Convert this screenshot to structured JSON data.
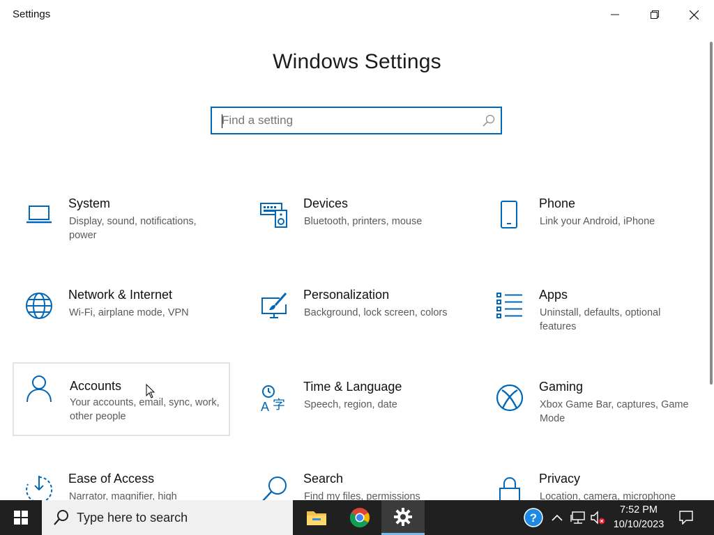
{
  "window": {
    "title": "Settings",
    "controls": {
      "minimize": "minimize-icon",
      "maximize": "restore-icon",
      "close": "close-icon"
    }
  },
  "main": {
    "heading": "Windows Settings",
    "search": {
      "placeholder": "Find a setting",
      "value": ""
    }
  },
  "categories": [
    {
      "title": "System",
      "description": "Display, sound, notifications, power",
      "icon": "laptop-icon"
    },
    {
      "title": "Devices",
      "description": "Bluetooth, printers, mouse",
      "icon": "keyboard-speaker-icon"
    },
    {
      "title": "Phone",
      "description": "Link your Android, iPhone",
      "icon": "phone-icon"
    },
    {
      "title": "Network & Internet",
      "description": "Wi-Fi, airplane mode, VPN",
      "icon": "globe-icon"
    },
    {
      "title": "Personalization",
      "description": "Background, lock screen, colors",
      "icon": "paintbrush-icon"
    },
    {
      "title": "Apps",
      "description": "Uninstall, defaults, optional features",
      "icon": "apps-list-icon"
    },
    {
      "title": "Accounts",
      "description": "Your accounts, email, sync, work, other people",
      "icon": "person-icon"
    },
    {
      "title": "Time & Language",
      "description": "Speech, region, date",
      "icon": "time-language-icon"
    },
    {
      "title": "Gaming",
      "description": "Xbox Game Bar, captures, Game Mode",
      "icon": "xbox-icon"
    },
    {
      "title": "Ease of Access",
      "description": "Narrator, magnifier, high",
      "icon": "ease-of-access-icon"
    },
    {
      "title": "Search",
      "description": "Find my files, permissions",
      "icon": "search-icon"
    },
    {
      "title": "Privacy",
      "description": "Location, camera, microphone",
      "icon": "lock-icon"
    }
  ],
  "taskbar": {
    "search_placeholder": "Type here to search",
    "clock": {
      "time": "7:52 PM",
      "date": "10/10/2023"
    },
    "colors": {
      "background": "#202020",
      "accent": "#0067b8"
    }
  }
}
